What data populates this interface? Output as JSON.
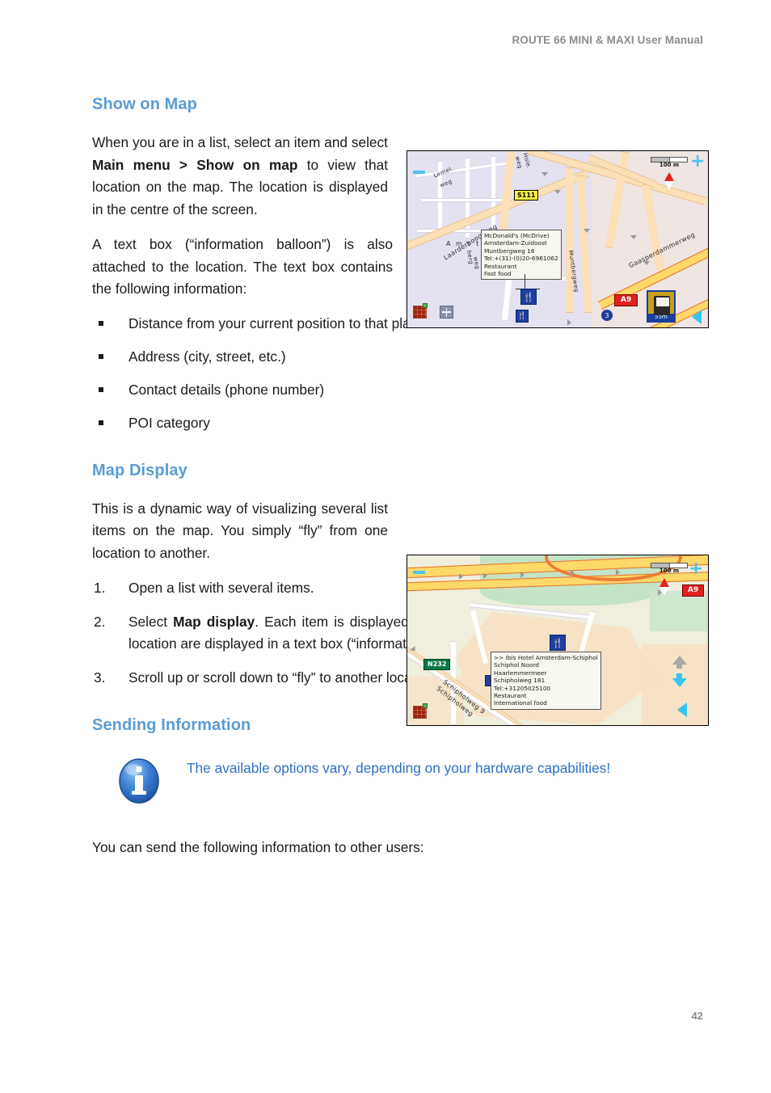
{
  "header": {
    "title": "ROUTE 66 MINI & MAXI User Manual"
  },
  "page_number": "42",
  "colors": {
    "heading": "#5B9BD5",
    "note_text": "#2F6FC4",
    "header_gray": "#8C8C8C"
  },
  "sections": {
    "show_on_map": {
      "heading": "Show on Map",
      "paragraph1_parts": {
        "a": "When you are in a list, select an item and select ",
        "b1": "Main menu > Show on map",
        "c": " to view that location on the map. The location is displayed in the centre of the screen."
      },
      "paragraph2": "A text box (“information balloon”) is also attached to the location. The text box contains the following information:",
      "bullets": [
        "Distance from your current position to that place",
        "Address (city, street, etc.)",
        "Contact details (phone number)",
        "POI category"
      ]
    },
    "map_display": {
      "heading": "Map Display",
      "paragraph1": "This is a dynamic way of visualizing several list items on the map. You simply “fly” from one location to another.",
      "steps": [
        {
          "num": "1.",
          "text": "Open a list with several items."
        },
        {
          "num": "2.",
          "pre": "Select ",
          "bold": "Map display",
          "post": ". Each item is displayed in the centre of the map. The details of each location are displayed in a text box (“information balloon”)."
        },
        {
          "num": "3.",
          "text": "Scroll up or scroll down to “fly” to another location."
        }
      ]
    },
    "sending_information": {
      "heading": "Sending Information",
      "note": "The available options vary, depending on your hardware capabilities!",
      "note_icon": "info-icon",
      "closing_paragraph": "You can send the following information to other users:"
    }
  },
  "figures": {
    "map1": {
      "caption_alt": "Navigation map showing McDonald's POI with information balloon",
      "scale_label": "100 m",
      "balloon_lines": [
        "McDonald's (McDrive)",
        "Amsterdam-Zuidoost",
        "Muntbergweg 16",
        "Tel:+(31)-(0)20-6961062",
        "Restaurant",
        "Fast food"
      ],
      "street_labels": [
        "Lemel.",
        "weg",
        "Hole.",
        "weg",
        "Laarderhoogtweg",
        "A m s t",
        "Muntbergweg",
        "Gaasperdammerweg",
        "berg",
        "weg"
      ],
      "road_shields": [
        {
          "text": "S111",
          "style": "yellow"
        },
        {
          "text": "A9",
          "style": "red"
        }
      ],
      "exit_number": "3",
      "device_thumb_label": "55m",
      "zoom_in": "+",
      "zoom_out": "−"
    },
    "map2": {
      "caption_alt": "Navigation map showing Ibis Hotel POI with information balloon",
      "scale_label": "100 m",
      "balloon_lines": [
        ">> Ibis Hotel Amsterdam-Schiphol",
        "Schiphol Noord",
        "Haarlemmermeer",
        "Schipholweg 181",
        "Tel:+31205025100",
        "Restaurant",
        "International food"
      ],
      "street_labels": [
        "Schipholweg 9",
        "Schipholweg"
      ],
      "road_shields": [
        {
          "text": "N232",
          "style": "green"
        },
        {
          "text": "A9",
          "style": "red"
        }
      ],
      "zoom_in": "+",
      "zoom_out": "−"
    }
  }
}
